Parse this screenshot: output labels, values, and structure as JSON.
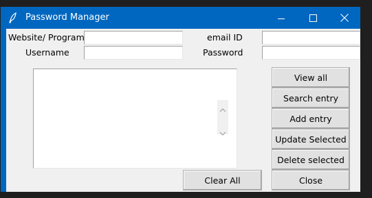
{
  "window": {
    "title": "Password Manager",
    "icons": {
      "app": "feather-icon",
      "minimize": "minimize-icon",
      "maximize": "maximize-icon",
      "close": "close-icon"
    },
    "colors": {
      "titlebar": "#0067c0",
      "client": "#f0f0f0"
    }
  },
  "form": {
    "website_label": "Website/ Program",
    "website_value": "",
    "email_label": "email ID",
    "email_value": "",
    "username_label": "Username",
    "username_value": "",
    "password_label": "Password",
    "password_value": ""
  },
  "buttons": {
    "view_all": "View all",
    "search_entry": "Search entry",
    "add_entry": "Add entry",
    "update_selected": "Update Selected",
    "delete_selected": "Delete selected",
    "clear_all": "Clear All",
    "close": "Close"
  },
  "listbox": {
    "items": []
  }
}
